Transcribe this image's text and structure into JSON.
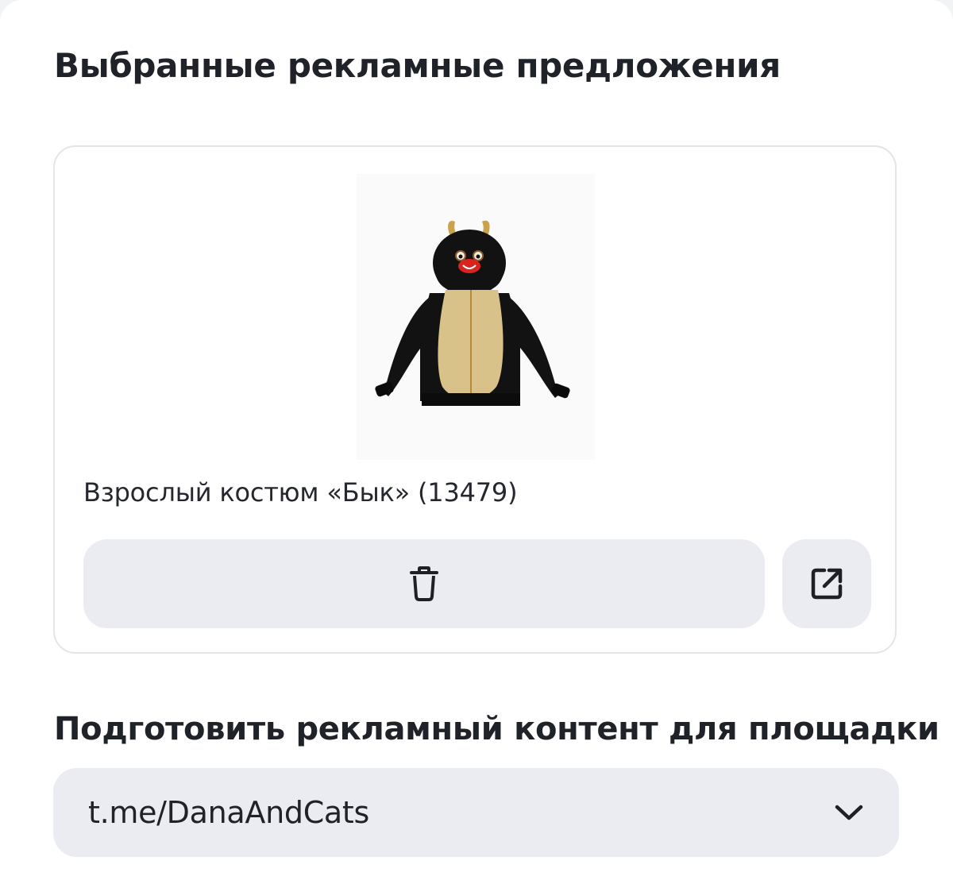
{
  "offers_section": {
    "title": "Выбранные рекламные предложения",
    "offer": {
      "image_icon": "bull-costume-jacket-image",
      "title": "Взрослый костюм «Бык» (13479)",
      "delete_icon": "trash-icon",
      "open_icon": "external-link-icon"
    }
  },
  "prepare_section": {
    "title": "Подготовить рекламный контент для площадки",
    "platform_select": {
      "value": "t.me/DanaAndCats",
      "icon": "chevron-down-icon"
    }
  },
  "colors": {
    "background": "#ffffff",
    "card_border": "#e3e5ea",
    "button_fill": "#ebecf1",
    "text": "#202229"
  }
}
